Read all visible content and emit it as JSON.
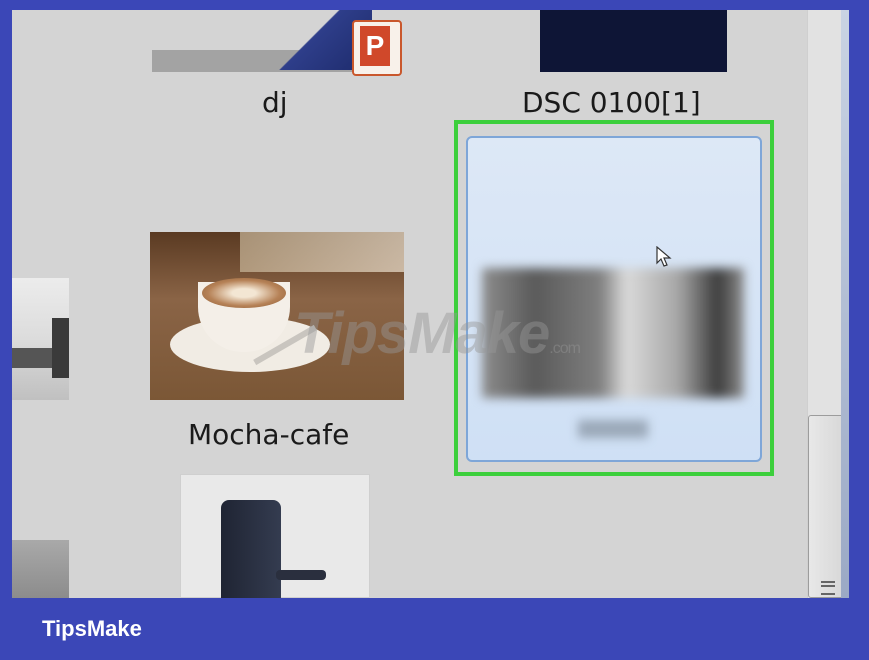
{
  "explorer": {
    "items": [
      {
        "label": "dj"
      },
      {
        "label": "DSC 0100[1]"
      },
      {
        "label": "Mocha-cafe"
      }
    ],
    "selected_outline_color": "#3ccf3c",
    "selected_bg_color": "#cfe0f5"
  },
  "icons": {
    "ppt_badge": "P"
  },
  "watermark": {
    "text": "TipsMake",
    "suffix": ".com"
  },
  "footer": {
    "brand": "TipsMake"
  }
}
